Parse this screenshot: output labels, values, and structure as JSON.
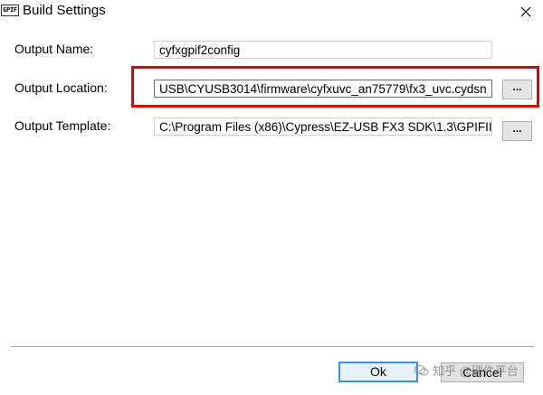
{
  "window": {
    "icon_text": "GPIF",
    "title": "Build Settings"
  },
  "form": {
    "output_name_label": "Output Name:",
    "output_name_value": "cyfxgpif2config",
    "output_location_label": "Output Location:",
    "output_location_value": "USB\\CYUSB3014\\firmware\\cyfxuvc_an75779\\fx3_uvc.cydsn",
    "output_template_label": "Output Template:",
    "output_template_value": "C:\\Program Files (x86)\\Cypress\\EZ-USB FX3 SDK\\1.3\\GPIFII",
    "browse_label": "..."
  },
  "footer": {
    "ok_label": "Ok",
    "cancel_label": "Cancel"
  },
  "watermark": {
    "text": "知乎 @硬件平台"
  },
  "colors": {
    "highlight": "#e00000",
    "ok_border": "#3c8fde"
  }
}
